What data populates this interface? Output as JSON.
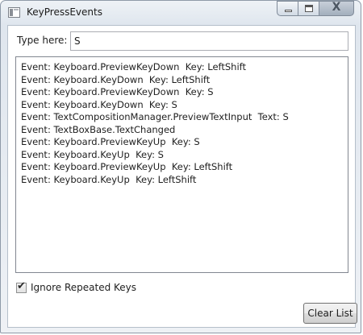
{
  "window": {
    "title": "KeyPressEvents",
    "icon": "app-window-icon"
  },
  "caption_buttons": {
    "minimize_icon": "minimize-icon",
    "maximize_icon": "maximize-icon",
    "close_glyph": "X"
  },
  "input": {
    "label": "Type here:",
    "value": "S"
  },
  "events": [
    "Event: Keyboard.PreviewKeyDown  Key: LeftShift",
    "Event: Keyboard.KeyDown  Key: LeftShift",
    "Event: Keyboard.PreviewKeyDown  Key: S",
    "Event: Keyboard.KeyDown  Key: S",
    "Event: TextCompositionManager.PreviewTextInput  Text: S",
    "Event: TextBoxBase.TextChanged",
    "Event: Keyboard.PreviewKeyUp  Key: S",
    "Event: Keyboard.KeyUp  Key: S",
    "Event: Keyboard.PreviewKeyUp  Key: LeftShift",
    "Event: Keyboard.KeyUp  Key: LeftShift"
  ],
  "options": {
    "ignore_repeated_label": "Ignore Repeated Keys",
    "ignore_repeated_checked": true,
    "check_glyph": "✔"
  },
  "actions": {
    "clear_label": "Clear List"
  }
}
